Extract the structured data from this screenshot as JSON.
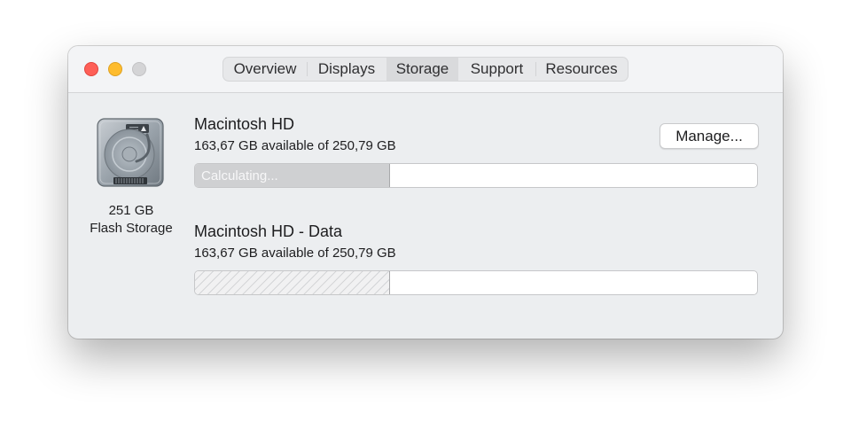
{
  "window": {
    "tabs": [
      {
        "label": "Overview",
        "active": false
      },
      {
        "label": "Displays",
        "active": false
      },
      {
        "label": "Storage",
        "active": true
      },
      {
        "label": "Support",
        "active": false
      },
      {
        "label": "Resources",
        "active": false
      }
    ]
  },
  "disk": {
    "icon": "hard-drive-icon",
    "capacity": "251 GB",
    "type": "Flash Storage"
  },
  "volumes": [
    {
      "name": "Macintosh HD",
      "availability": "163,67 GB available of 250,79 GB",
      "bar_label": "Calculating...",
      "used_fraction": 0.3475,
      "fill_style": "solid"
    },
    {
      "name": "Macintosh HD - Data",
      "availability": "163,67 GB available of 250,79 GB",
      "bar_label": "",
      "used_fraction": 0.3475,
      "fill_style": "hatched"
    }
  ],
  "buttons": {
    "manage_label": "Manage..."
  },
  "colors": {
    "close": "#fe5f57",
    "minimize": "#febc2e",
    "zoom_inactive": "#d4d4d6",
    "window_bg": "#eceef0",
    "bar_fill": "#cfd0d2"
  }
}
